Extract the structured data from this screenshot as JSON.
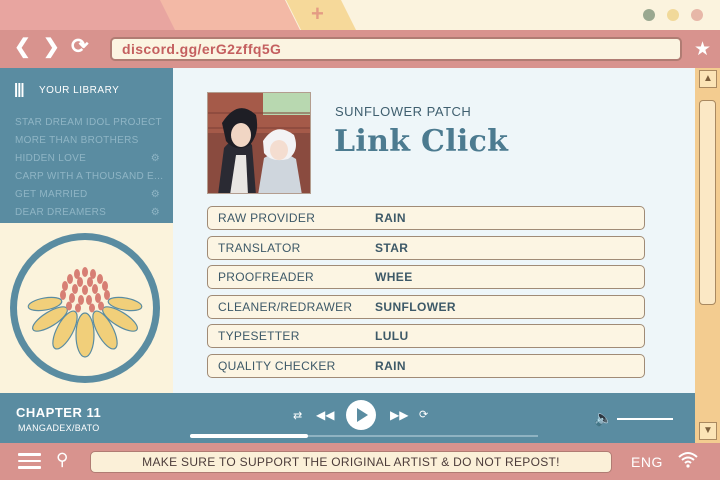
{
  "browser": {
    "tab_label": "",
    "url": "discord.gg/erG2zffq5G",
    "dots": [
      "#9aa890",
      "#f1d99a",
      "#e7b7a8"
    ]
  },
  "sidebar": {
    "title": "YOUR LIBRARY",
    "items": [
      {
        "label": "STAR DREAM IDOL PROJECT",
        "locked": false
      },
      {
        "label": "MORE THAN BROTHERS",
        "locked": false
      },
      {
        "label": "HIDDEN LOVE",
        "locked": true
      },
      {
        "label": "CARP WITH A THOUSAND E...",
        "locked": false
      },
      {
        "label": "GET MARRIED",
        "locked": true
      },
      {
        "label": "DEAR DREAMERS",
        "locked": true
      }
    ]
  },
  "series": {
    "group": "SUNFLOWER PATCH",
    "title": "Link Click"
  },
  "credits": [
    {
      "role": "RAW PROVIDER",
      "name": "RAIN"
    },
    {
      "role": "TRANSLATOR",
      "name": "STAR"
    },
    {
      "role": "PROOFREADER",
      "name": "WHEE"
    },
    {
      "role": "CLEANER/REDRAWER",
      "name": "SUNFLOWER"
    },
    {
      "role": "TYPESETTER",
      "name": "LULU"
    },
    {
      "role": "QUALITY CHECKER",
      "name": "RAIN"
    }
  ],
  "player": {
    "chapter": "CHAPTER 11",
    "source": "MANGADEX/BATO",
    "progress": 0.34
  },
  "footer": {
    "notice": "MAKE SURE TO SUPPORT THE ORIGINAL ARTIST & DO NOT REPOST!",
    "language": "ENG"
  },
  "colors": {
    "frame": "#d8938e",
    "accent_blue": "#5a8ca1",
    "cream": "#fbf3dc",
    "title_blue": "#4c7b90"
  }
}
